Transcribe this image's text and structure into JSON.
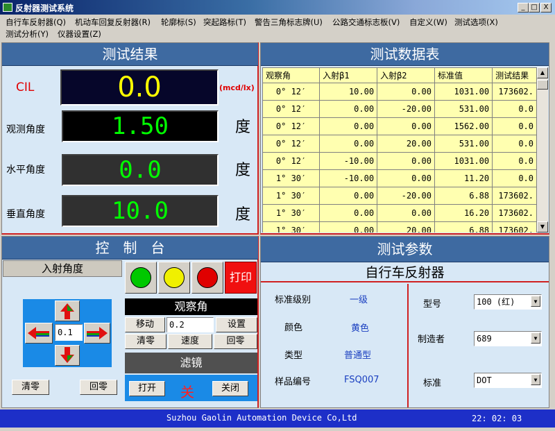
{
  "window": {
    "title": "反射器测试系统",
    "min": "_",
    "max": "□",
    "close": "X"
  },
  "menu": {
    "row1": [
      "自行车反射器(Q)",
      "机动车回复反射器(R)",
      "轮廓标(S)",
      "突起路标(T)",
      "警告三角标志牌(U)",
      "公路交通标志板(V)",
      "自定义(W)",
      "测试选项(X)"
    ],
    "row2": [
      "测试分析(Y)",
      "仪器设置(Z)"
    ]
  },
  "results": {
    "header": "测试结果",
    "cil_label": "CIL",
    "cil_value": "0.0",
    "cil_unit": "(mcd/lx)",
    "obs_label": "观测角度",
    "obs_value": "1.50",
    "hor_label": "水平角度",
    "hor_value": "0.0",
    "ver_label": "垂直角度",
    "ver_value": "10.0",
    "deg": "度",
    "colors": {
      "cil": "#ffff00",
      "angle": "#00ff00"
    }
  },
  "datatable": {
    "header": "测试数据表",
    "columns": [
      "观察角",
      "入射β1",
      "入射β2",
      "标准值",
      "测试结果"
    ],
    "rows": [
      [
        "0° 12′",
        "10.00",
        "0.00",
        "1031.00",
        "173602."
      ],
      [
        "0° 12′",
        "0.00",
        "-20.00",
        "531.00",
        "0.0"
      ],
      [
        "0° 12′",
        "0.00",
        "0.00",
        "1562.00",
        "0.0"
      ],
      [
        "0° 12′",
        "0.00",
        "20.00",
        "531.00",
        "0.0"
      ],
      [
        "0° 12′",
        "-10.00",
        "0.00",
        "1031.00",
        "0.0"
      ],
      [
        "1° 30′",
        "-10.00",
        "0.00",
        "11.20",
        "0.0"
      ],
      [
        "1° 30′",
        "0.00",
        "-20.00",
        "6.88",
        "173602."
      ],
      [
        "1° 30′",
        "0.00",
        "0.00",
        "16.20",
        "173602."
      ],
      [
        "1° 30′",
        "0.00",
        "20.00",
        "6.88",
        "173602."
      ]
    ]
  },
  "console": {
    "header": "控　制　台",
    "incident": {
      "title": "入射角度",
      "value": "0.1",
      "clear": "清零",
      "return": "回零"
    },
    "lamps": {
      "green": "#00c800",
      "yellow": "#f0f000",
      "red": "#e00000"
    },
    "print": "打印",
    "observe": {
      "title": "观察角",
      "move_label": "移动",
      "move_value": "0.2",
      "set": "设置",
      "clear": "清零",
      "speed": "速度",
      "return": "回零"
    },
    "filter": {
      "title": "滤镜",
      "open": "打开",
      "state": "关",
      "close": "关闭"
    }
  },
  "params": {
    "header": "测试参数",
    "product": "自行车反射器",
    "std_level_label": "标准级别",
    "std_level_value": "一级",
    "color_label": "颜色",
    "color_value": "黄色",
    "type_label": "类型",
    "type_value": "普通型",
    "sample_label": "样品编号",
    "sample_value": "FSQ007",
    "model_label": "型号",
    "model_value": "100 (红)",
    "maker_label": "制造者",
    "maker_value": "689",
    "standard_label": "标准",
    "standard_value": "DOT"
  },
  "status": {
    "company": "Suzhou Gaolin Automation Device Co,Ltd",
    "time": "22: 02: 03"
  }
}
